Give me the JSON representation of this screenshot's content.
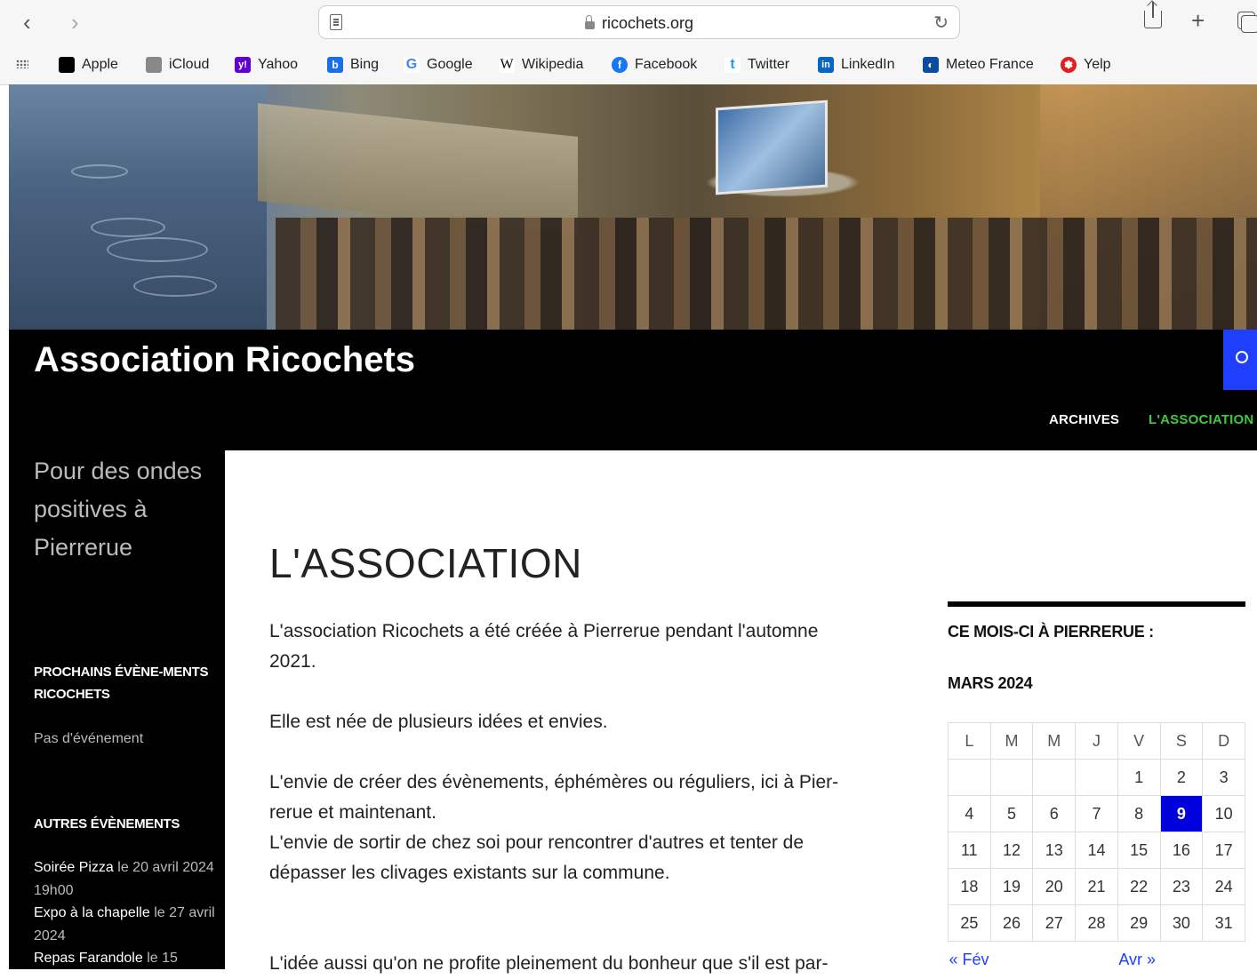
{
  "browser": {
    "back_glyph": "‹",
    "forward_glyph": "›",
    "url": "ricochets.org",
    "plus_glyph": "+",
    "reload_glyph": "↻"
  },
  "bookmarks": [
    {
      "label": "Apple",
      "icon": "apple-icon",
      "glyph": "",
      "color": "#000000"
    },
    {
      "label": "iCloud",
      "icon": "apple-icon",
      "glyph": "",
      "color": "#888888"
    },
    {
      "label": "Yahoo",
      "icon": "yahoo-icon",
      "glyph": "y!",
      "color": "#5f01d1"
    },
    {
      "label": "Bing",
      "icon": "bing-icon",
      "glyph": "b",
      "color": "#1b6fe6"
    },
    {
      "label": "Google",
      "icon": "google-icon",
      "glyph": "G",
      "color": "#4285f4"
    },
    {
      "label": "Wikipedia",
      "icon": "wikipedia-icon",
      "glyph": "W",
      "color": "#000000"
    },
    {
      "label": "Facebook",
      "icon": "facebook-icon",
      "glyph": "f",
      "color": "#1877f2"
    },
    {
      "label": "Twitter",
      "icon": "twitter-icon",
      "glyph": "t",
      "color": "#1d9bf0"
    },
    {
      "label": "LinkedIn",
      "icon": "linkedin-icon",
      "glyph": "in",
      "color": "#0a66c2"
    },
    {
      "label": "Meteo France",
      "icon": "meteo-france-icon",
      "glyph": "◐",
      "color": "#0a4ca0"
    },
    {
      "label": "Yelp",
      "icon": "yelp-icon",
      "glyph": "✽",
      "color": "#e02020"
    }
  ],
  "site": {
    "title": "Association Ricochets",
    "menu": [
      "ARCHIVES",
      "L'ASSOCIATION"
    ],
    "accent_color": "#41c93e",
    "search_color": "#1f3fff"
  },
  "sidebar": {
    "tagline": "Pour des ondes positives à Pierrerue",
    "upcoming_title": "PROCHAINS ÉVÈNE-MENTS RICOCHETS",
    "no_event": "Pas d'événement",
    "other_title": "AUTRES ÉVÈNEMENTS",
    "events": [
      {
        "name": "Soirée Pizza",
        "date": " le 20 avril 2024 19h00"
      },
      {
        "name": "Expo à la chapelle",
        "date": " le 27 avril 2024"
      },
      {
        "name": "Repas Farandole",
        "date": " le 15"
      }
    ]
  },
  "main": {
    "page_title": "L'ASSOCIATION",
    "paragraphs": [
      "L'association Ricochets a été créée à Pierrerue pendant l'automne 2021.",
      "Elle est née de plusieurs idées et envies.",
      "L'envie de créer des évènements, éphémères ou réguliers, ici à Pier-rerue et maintenant.",
      "L'envie de sortir de chez soi pour rencontrer d'autres et tenter de dépasser les clivages existants sur la commune.",
      "L'idée aussi qu'on ne profite pleinement du bonheur que s'il est par-"
    ]
  },
  "calendar": {
    "widget_title": "CE MOIS-CI À PIERRERUE :",
    "month": "MARS 2024",
    "days": [
      "L",
      "M",
      "M",
      "J",
      "V",
      "S",
      "D"
    ],
    "weeks": [
      [
        "",
        "",
        "",
        "",
        "1",
        "2",
        "3"
      ],
      [
        "4",
        "5",
        "6",
        "7",
        "8",
        "9",
        "10"
      ],
      [
        "11",
        "12",
        "13",
        "14",
        "15",
        "16",
        "17"
      ],
      [
        "18",
        "19",
        "20",
        "21",
        "22",
        "23",
        "24"
      ],
      [
        "25",
        "26",
        "27",
        "28",
        "29",
        "30",
        "31"
      ]
    ],
    "today": "9",
    "prev": "« Fév",
    "next": "Avr »"
  }
}
